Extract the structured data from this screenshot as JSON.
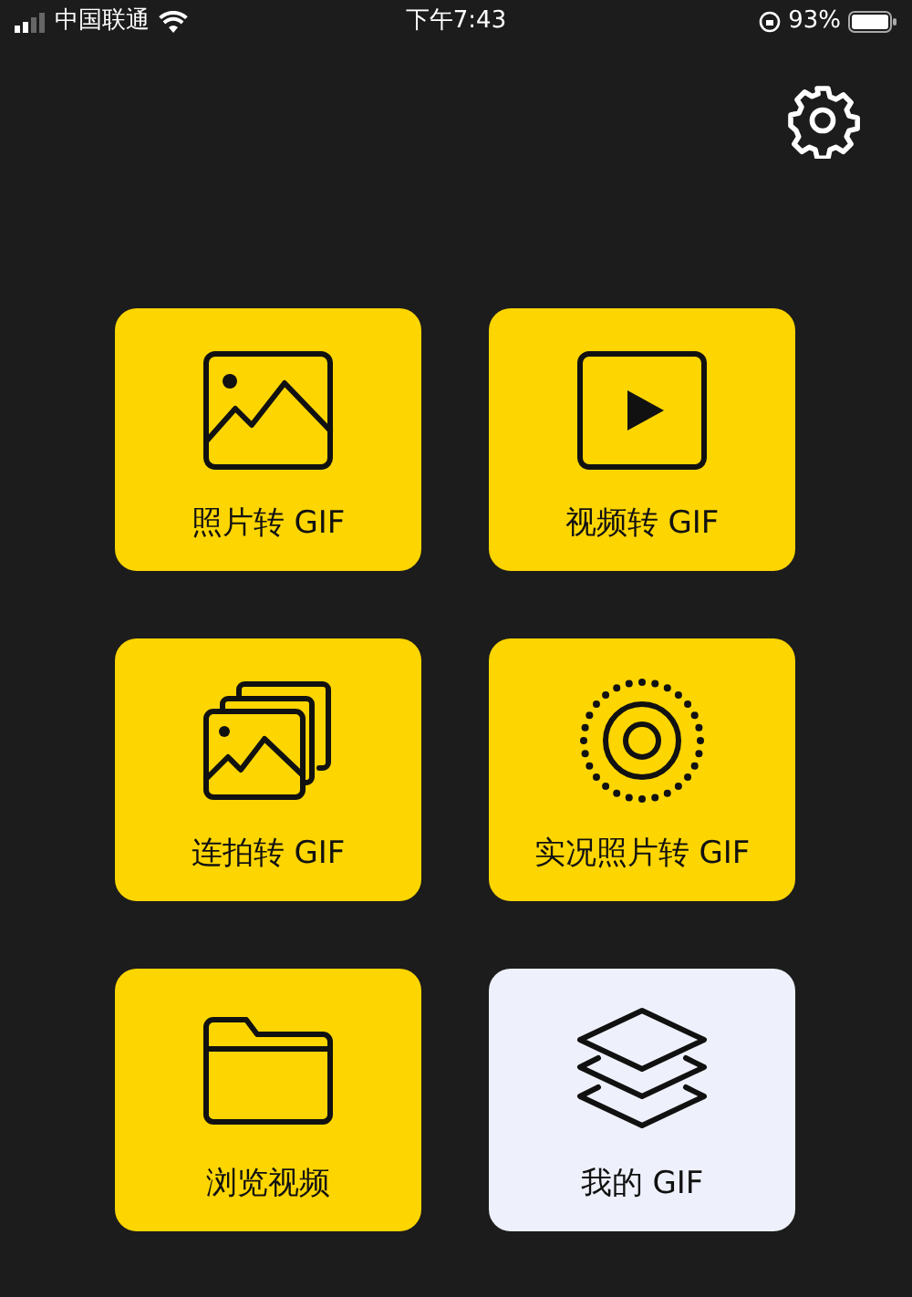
{
  "status_bar": {
    "carrier": "中国联通",
    "time": "下午7:43",
    "battery": "93%"
  },
  "tiles": [
    {
      "kind": "photo",
      "label": "照片转 GIF",
      "color": "#fdd500"
    },
    {
      "kind": "video",
      "label": "视频转 GIF",
      "color": "#fdd500"
    },
    {
      "kind": "burst",
      "label": "连拍转 GIF",
      "color": "#fdd500"
    },
    {
      "kind": "live",
      "label": "实况照片转 GIF",
      "color": "#fdd500"
    },
    {
      "kind": "folder",
      "label": "浏览视频",
      "color": "#fdd500"
    },
    {
      "kind": "layers",
      "label": "我的 GIF",
      "color": "#eef1fb"
    }
  ]
}
